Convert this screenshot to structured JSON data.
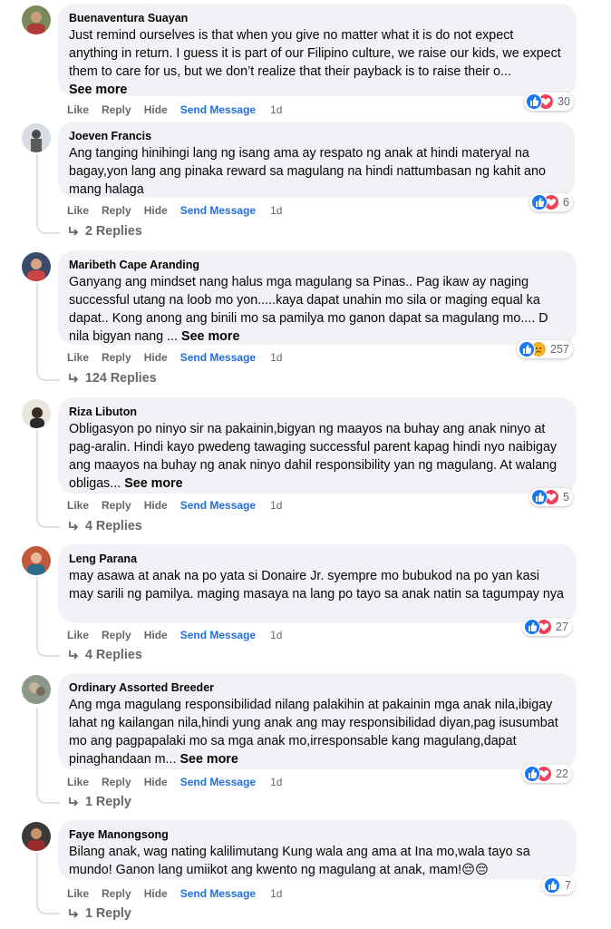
{
  "colors": {
    "bubble": "#f0f2f5",
    "muted": "#65676b",
    "link": "#216fdb",
    "like_blue": "#1877f2",
    "heart_red": "#f33e58",
    "sad_yellow": "#f7b125"
  },
  "labels": {
    "like": "Like",
    "reply": "Reply",
    "hide": "Hide",
    "send_message": "Send Message",
    "see_more": "See more"
  },
  "comments": [
    {
      "author": "Buenaventura Suayan",
      "text": "Just remind ourselves is that when you give no matter what it is do not expect anything in return. I guess it is part of our Filipino culture, we raise our kids, we expect them to care for us, but we don’t realize that their payback is to raise their o...",
      "see_more": "See more",
      "reactions": [
        "like",
        "heart"
      ],
      "reaction_count": "30",
      "time": "1d",
      "replies": ""
    },
    {
      "author": "Joeven Francis",
      "text": "Ang tanging hinihingi lang ng isang ama ay respato ng anak at hindi materyal na bagay,yon lang ang pinaka reward sa magulang na hindi nattumbasan ng kahit ano mang halaga",
      "see_more": "",
      "reactions": [
        "like",
        "heart"
      ],
      "reaction_count": "6",
      "time": "1d",
      "replies": "2 Replies"
    },
    {
      "author": "Maribeth Cape Aranding",
      "text": "Ganyang ang mindset nang halus mga magulang sa Pinas.. Pag ikaw ay naging successful utang na loob mo yon.....kaya dapat unahin mo sila or maging equal ka dapat.. Kong anong ang binili mo sa pamilya mo ganon dapat sa magulang mo.... D nila bigyan nang ...",
      "see_more": "See more",
      "reactions": [
        "like",
        "sad"
      ],
      "reaction_count": "257",
      "time": "1d",
      "replies": "124 Replies"
    },
    {
      "author": "Riza Libuton",
      "text": "Obligasyon po ninyo sir na pakainin,bigyan ng maayos na buhay ang anak ninyo at pag-aralin. Hindi kayo pwedeng tawaging successful parent kapag hindi nyo naibigay ang maayos na buhay ng anak ninyo dahil responsibility yan ng magulang. At walang obligas...",
      "see_more": "See more",
      "reactions": [
        "like",
        "heart"
      ],
      "reaction_count": "5",
      "time": "1d",
      "replies": "4 Replies"
    },
    {
      "author": "Leng Parana",
      "text": "may asawa at anak na po yata si Donaire Jr. syempre mo bubukod na po yan kasi may sarili ng pamilya. maging masaya na lang po tayo sa anak natin sa tagumpay nya",
      "see_more": "",
      "reactions": [
        "like",
        "heart"
      ],
      "reaction_count": "27",
      "time": "1d",
      "replies": "4 Replies"
    },
    {
      "author": "Ordinary Assorted Breeder",
      "text": "Ang mga magulang responsibilidad nilang palakihin at pakainin mga anak nila,ibigay lahat ng kailangan nila,hindi yung anak ang may responsibilidad diyan,pag isusumbat mo ang pagpapalaki mo sa mga anak mo,irresponsable kang magulang,dapat pinaghandaan m...",
      "see_more": "See more",
      "reactions": [
        "like",
        "heart"
      ],
      "reaction_count": "22",
      "time": "1d",
      "replies": "1 Reply"
    },
    {
      "author": "Faye Manongsong",
      "text": "Bilang anak, wag nating kalilimutang Kung wala ang ama at Ina mo,wala tayo sa mundo! Ganon lang umiikot ang kwento ng magulang at anak, mam!😔😔",
      "see_more": "",
      "reactions": [
        "like"
      ],
      "reaction_count": "7",
      "time": "1d",
      "replies": "1 Reply"
    }
  ]
}
